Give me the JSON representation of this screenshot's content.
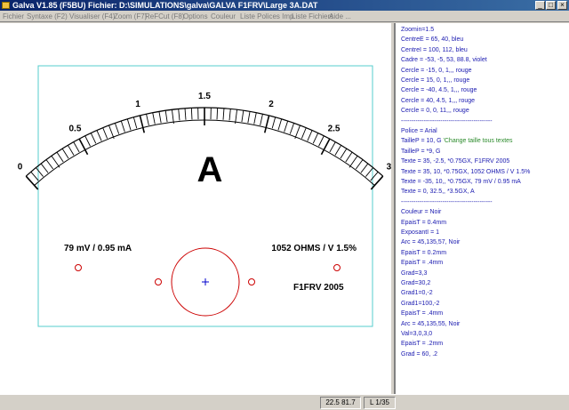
{
  "window": {
    "title": "Galva  V1.85   (F5BU)   Fichier: D:\\SIMULATIONS\\galva\\GALVA F1FRV\\Large 3A.DAT",
    "minimize": "_",
    "maximize": "□",
    "close": "×"
  },
  "menu": [
    "Fichier",
    "Syntaxe (F2)",
    "Visualiser (F4)",
    "Zoom (F7)",
    "ReFCut (F8)",
    "Options",
    "Couleur",
    "Liste Polices Imp.",
    "Liste Fichiers",
    "Aide ..."
  ],
  "meter": {
    "scale_labels": [
      "0",
      "0.5",
      "1",
      "1.5",
      "2",
      "2.5",
      "3"
    ],
    "scale_min": 0,
    "scale_max": 3,
    "unit_letter": "A",
    "left_text": "79  mV / 0.95 mA",
    "right_text": "1052 OHMS / V   1.5%",
    "signature": "F1FRV 2005",
    "frame_color": "#55cccc",
    "circle_color": "#cc0000",
    "center_color": "#0000cc"
  },
  "script": {
    "lines": [
      {
        "text": "Zoomin=1.5",
        "type": "code"
      },
      {
        "text": "CentreE = 65, 40, bleu",
        "type": "code"
      },
      {
        "text": "CentreI = 100, 112, bleu",
        "type": "code"
      },
      {
        "text": "Cadre = -53, -5, 53, 88.8, violet",
        "type": "code"
      },
      {
        "text": "Cercle = -15, 0, 1,,, rouge",
        "type": "code"
      },
      {
        "text": "Cercle = 15, 0, 1,,, rouge",
        "type": "code"
      },
      {
        "text": "Cercle = -40, 4.5, 1,,, rouge",
        "type": "code"
      },
      {
        "text": "Cercle = 40, 4.5, 1,,, rouge",
        "type": "code"
      },
      {
        "text": "Cercle = 0, 0, 11,,, rouge",
        "type": "code"
      },
      {
        "text": "--------------------------------------------",
        "type": "code"
      },
      {
        "text": "Police = Arial",
        "type": "code"
      },
      {
        "text": "TailleP = 10, G",
        "type": "code",
        "comment": "'Change taille tous textes"
      },
      {
        "text": "TailleP = *9, G",
        "type": "code"
      },
      {
        "text": "Texte = 35, -2.5, *0.75GX, F1FRV 2005",
        "type": "code"
      },
      {
        "text": "Texte = 35, 10, *0.75GX, 1052 OHMS / V   1.5%",
        "type": "code"
      },
      {
        "text": "Texte = -35, 10,, *0.75GX, 79  mV / 0.95 mA",
        "type": "code"
      },
      {
        "text": "Texte = 0, 32.5,, *3.5GX, A",
        "type": "code"
      },
      {
        "text": "--------------------------------------------",
        "type": "code"
      },
      {
        "text": "Couleur = Noir",
        "type": "code"
      },
      {
        "text": "EpaisT = 0.4mm",
        "type": "code"
      },
      {
        "text": "ExposantI = 1",
        "type": "code"
      },
      {
        "text": "Arc = 45,135,57, Noir",
        "type": "code"
      },
      {
        "text": "EpaisT = 0.2mm",
        "type": "code"
      },
      {
        "text": "EpaisT = .4mm",
        "type": "code"
      },
      {
        "text": "Grad=3,3",
        "type": "code"
      },
      {
        "text": "Grad=30,2",
        "type": "code"
      },
      {
        "text": "Grad1=0,-2",
        "type": "code"
      },
      {
        "text": "Grad1=100,-2",
        "type": "code"
      },
      {
        "text": "EpaisT = .4mm",
        "type": "code"
      },
      {
        "text": "Arc = 45,135,55, Noir",
        "type": "code"
      },
      {
        "text": "Val=3,0,3,0",
        "type": "code"
      },
      {
        "text": "EpaisT = .2mm",
        "type": "code"
      },
      {
        "text": "Grad = 60, .2",
        "type": "code"
      }
    ]
  },
  "status": {
    "coords": "22.5  81.7",
    "line": "L 1/35"
  }
}
